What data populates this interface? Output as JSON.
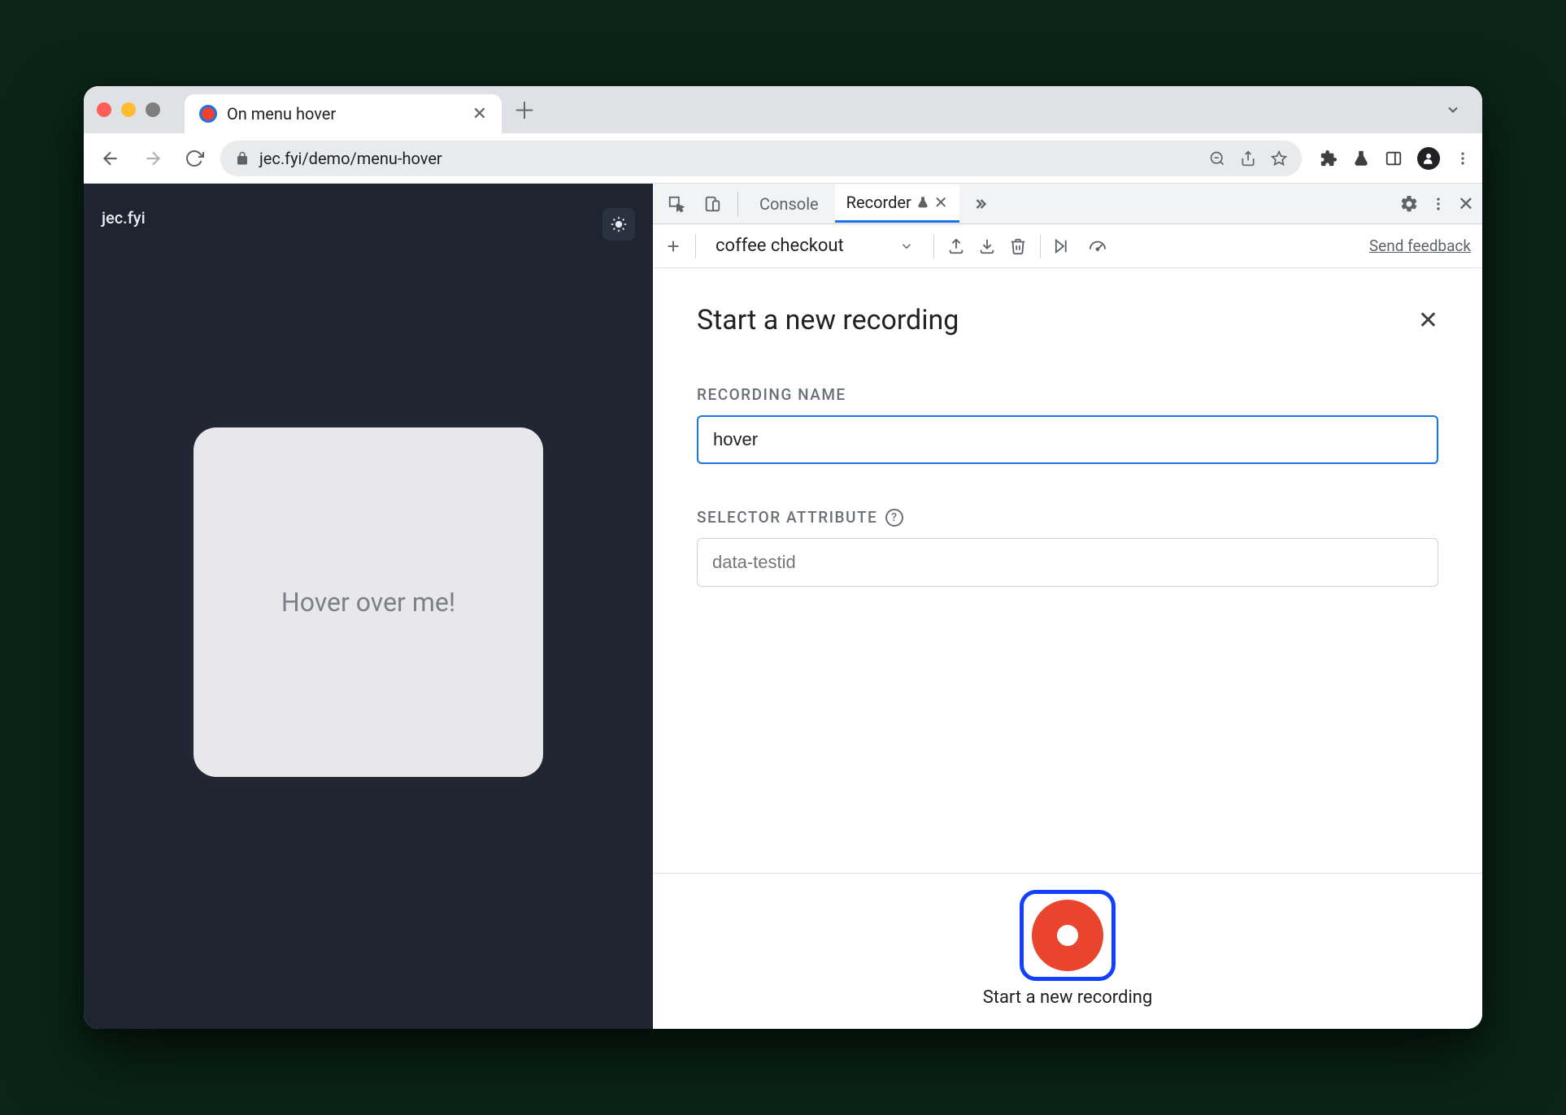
{
  "browser": {
    "tab_title": "On menu hover",
    "url": "jec.fyi/demo/menu-hover"
  },
  "page": {
    "site_label": "jec.fyi",
    "card_text": "Hover over me!"
  },
  "devtools": {
    "tabs": {
      "console": "Console",
      "recorder": "Recorder"
    },
    "toolbar": {
      "recording_dropdown": "coffee checkout",
      "feedback": "Send feedback"
    },
    "recorder": {
      "title": "Start a new recording",
      "name_label": "RECORDING NAME",
      "name_value": "hover",
      "selector_label": "SELECTOR ATTRIBUTE",
      "selector_placeholder": "data-testid",
      "start_caption": "Start a new recording"
    }
  }
}
